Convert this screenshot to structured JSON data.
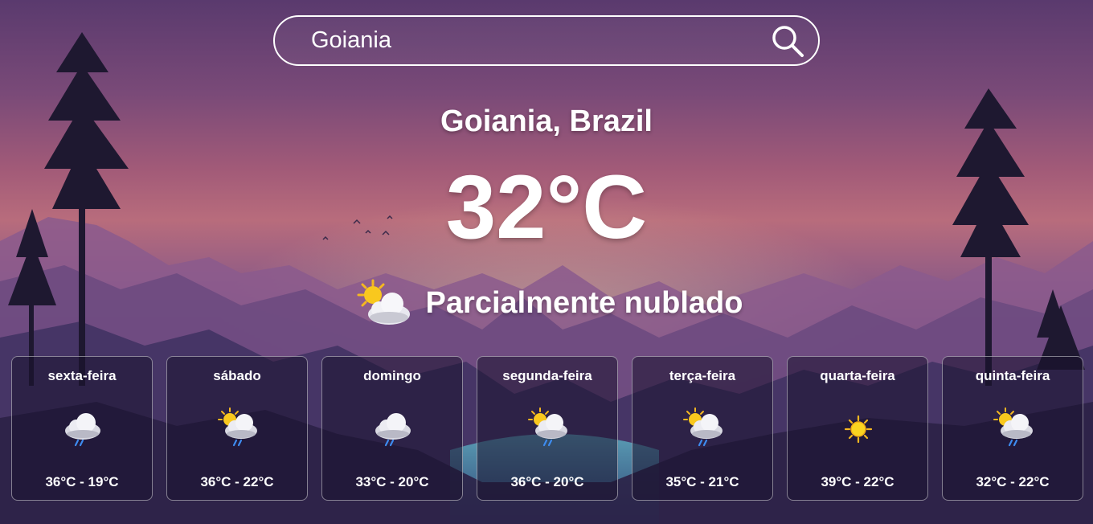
{
  "search": {
    "value": "Goiania"
  },
  "location": "Goiania, Brazil",
  "current": {
    "temperature": "32°C",
    "condition": "Parcialmente nublado",
    "icon": "partly-cloudy-icon"
  },
  "forecast": [
    {
      "day": "sexta-feira",
      "range": "36°C - 19°C",
      "icon": "cloud-rain-icon"
    },
    {
      "day": "sábado",
      "range": "36°C - 22°C",
      "icon": "sun-cloud-rain-icon"
    },
    {
      "day": "domingo",
      "range": "33°C - 20°C",
      "icon": "cloud-rain-icon"
    },
    {
      "day": "segunda-feira",
      "range": "36°C - 20°C",
      "icon": "sun-cloud-rain-icon"
    },
    {
      "day": "terça-feira",
      "range": "35°C - 21°C",
      "icon": "sun-cloud-rain-icon"
    },
    {
      "day": "quarta-feira",
      "range": "39°C - 22°C",
      "icon": "sun-icon"
    },
    {
      "day": "quinta-feira",
      "range": "32°C - 22°C",
      "icon": "sun-cloud-rain-icon"
    }
  ]
}
